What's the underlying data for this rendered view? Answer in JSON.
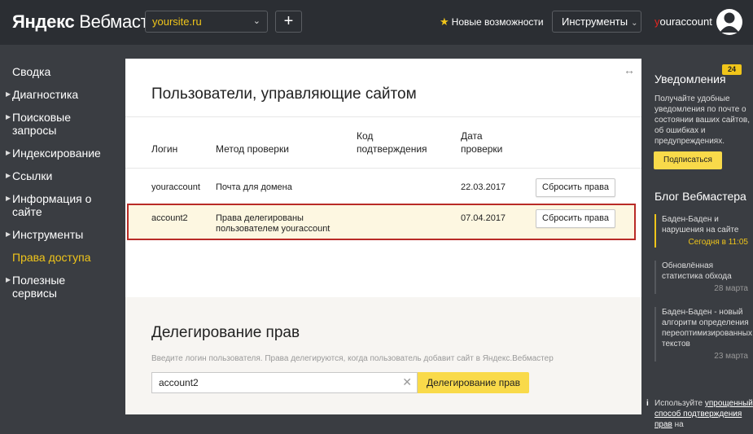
{
  "header": {
    "logo_brand": "Яндекс",
    "logo_product": "Вебмастер",
    "site": "yoursite.ru",
    "add_label": "+",
    "features_label": "Новые возможности",
    "tools_label": "Инструменты",
    "account_first": "y",
    "account_rest": "ouraccount"
  },
  "sidebar": {
    "items": [
      {
        "label": "Сводка"
      },
      {
        "label": "Диагностика"
      },
      {
        "label": "Поисковые запросы"
      },
      {
        "label": "Индексирование"
      },
      {
        "label": "Ссылки"
      },
      {
        "label": "Информация о сайте"
      },
      {
        "label": "Инструменты"
      },
      {
        "label": "Права доступа"
      },
      {
        "label": "Полезные сервисы"
      }
    ],
    "active": "Права доступа"
  },
  "users": {
    "title": "Пользователи, управляющие сайтом",
    "columns": {
      "login": "Логин",
      "method": "Метод проверки",
      "code": "Код подтверждения",
      "date": "Дата проверки"
    },
    "rows": [
      {
        "login": "youraccount",
        "method": "Почта для домена",
        "code": "",
        "date": "22.03.2017",
        "action": "Сбросить права"
      },
      {
        "login": "account2",
        "method": "Права делегированы пользователем youraccount",
        "code": "",
        "date": "07.04.2017",
        "action": "Сбросить права"
      }
    ]
  },
  "delegation": {
    "title": "Делегирование прав",
    "hint": "Введите логин пользователя. Права делегируются, когда пользователь добавит сайт в Яндекс.Вебмастер",
    "input_value": "account2",
    "button": "Делегирование прав"
  },
  "notifications": {
    "title": "Уведомления",
    "badge": "24",
    "text": "Получайте удобные уведомления по почте о состоянии ваших сайтов, об ошибках и предупреждениях.",
    "subscribe": "Подписаться"
  },
  "blog": {
    "title": "Блог Вебмастера",
    "items": [
      {
        "text": "Баден-Баден и нарушения на сайте",
        "date": "Сегодня в 11:05"
      },
      {
        "text": "Обновлённая статистика обхода",
        "date": "28 марта"
      },
      {
        "text": "Баден-Баден - новый алгоритм определения переоптимизированных текстов",
        "date": "23 марта"
      }
    ]
  },
  "info": {
    "prefix": "Используйте",
    "link": "упрощенный способ подтверждения прав",
    "suffix": "на"
  },
  "colors": {
    "accent": "#f0c51a",
    "highlight_border": "#b92b27",
    "header_bg": "#2b2e33",
    "page_bg": "#3a3d42"
  }
}
